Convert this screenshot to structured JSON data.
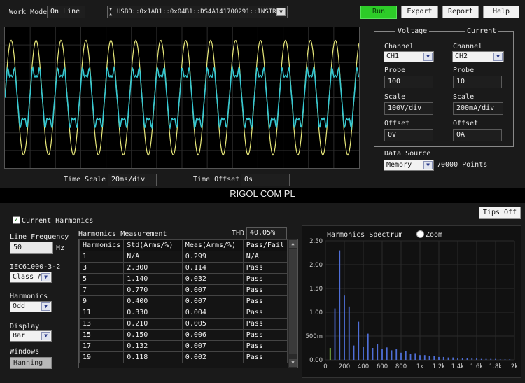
{
  "topbar": {
    "work_mode_label": "Work Mode",
    "work_mode_value": "On Line",
    "resource_value": "USB0::0x1AB1::0x04B1::DS4A141700291::INSTR",
    "buttons": {
      "run": "Run",
      "export": "Export",
      "report": "Report",
      "help": "Help"
    }
  },
  "colors": {
    "run_button": "#2dcc28",
    "voltage_trace": "#e8e87a",
    "current_trace": "#35c8d2",
    "spectrum_bar": "#4f6fd8",
    "spectrum_fundamental": "#8fd14f"
  },
  "scope": {
    "time_scale_label": "Time Scale",
    "time_scale_value": "20ms/div",
    "time_offset_label": "Time Offset",
    "time_offset_value": "0s"
  },
  "voltage": {
    "title": "Voltage",
    "channel_label": "Channel",
    "channel_value": "CH1",
    "probe_label": "Probe",
    "probe_value": "100",
    "scale_label": "Scale",
    "scale_value": "100V/div",
    "offset_label": "Offset",
    "offset_value": "0V"
  },
  "current": {
    "title": "Current",
    "channel_label": "Channel",
    "channel_value": "CH2",
    "probe_label": "Probe",
    "probe_value": "10",
    "scale_label": "Scale",
    "scale_value": "200mA/div",
    "offset_label": "Offset",
    "offset_value": "0A"
  },
  "data_source": {
    "label": "Data Source",
    "value": "Memory",
    "points": "70000 Points"
  },
  "watermark": "RIGOL COM PL",
  "harmonics_panel": {
    "checkbox_label": "Current Harmonics",
    "line_frequency_label": "Line Frequency",
    "line_frequency_value": "50",
    "line_frequency_unit": "Hz",
    "standard_label": "IEC61000-3-2",
    "standard_value": "Class A",
    "harmonics_label": "Harmonics",
    "harmonics_value": "Odd",
    "display_label": "Display",
    "display_value": "Bar",
    "windows_label": "Windows",
    "windows_value": "Hanning",
    "tips_button": "Tips Off"
  },
  "measurement": {
    "title": "Harmonics Measurement",
    "thd_label": "THD",
    "thd_value": "40.05%",
    "columns": [
      "Harmonics",
      "Std(Arms/%)",
      "Meas(Arms/%)",
      "Pass/Fail"
    ],
    "rows": [
      [
        "1",
        "N/A",
        "0.299",
        "N/A"
      ],
      [
        "3",
        "2.300",
        "0.114",
        "Pass"
      ],
      [
        "5",
        "1.140",
        "0.032",
        "Pass"
      ],
      [
        "7",
        "0.770",
        "0.007",
        "Pass"
      ],
      [
        "9",
        "0.400",
        "0.007",
        "Pass"
      ],
      [
        "11",
        "0.330",
        "0.004",
        "Pass"
      ],
      [
        "13",
        "0.210",
        "0.005",
        "Pass"
      ],
      [
        "15",
        "0.150",
        "0.006",
        "Pass"
      ],
      [
        "17",
        "0.132",
        "0.007",
        "Pass"
      ],
      [
        "19",
        "0.118",
        "0.002",
        "Pass"
      ]
    ]
  },
  "spectrum": {
    "title": "Harmonics Spectrum",
    "zoom_label": "Zoom"
  },
  "chart_data": {
    "type": "bar",
    "title": "Harmonics Spectrum",
    "x_tick_labels": [
      "0",
      "200",
      "400",
      "600",
      "800",
      "1k",
      "1.2k",
      "1.4k",
      "1.6k",
      "1.8k",
      "2k"
    ],
    "y_tick_labels": [
      "0.00",
      "500m",
      "1.00",
      "1.50",
      "2.00",
      "2.50"
    ],
    "xlim": [
      0,
      2000
    ],
    "ylim": [
      0,
      2.5
    ],
    "x": [
      50,
      100,
      150,
      200,
      250,
      300,
      350,
      400,
      450,
      500,
      550,
      600,
      650,
      700,
      750,
      800,
      850,
      900,
      950,
      1000,
      1050,
      1100,
      1150,
      1200,
      1250,
      1300,
      1350,
      1400,
      1450,
      1500,
      1550,
      1600,
      1650,
      1700,
      1750,
      1800,
      1850,
      1900,
      1950
    ],
    "values": [
      0.25,
      1.08,
      2.3,
      1.35,
      1.12,
      0.3,
      0.8,
      0.28,
      0.55,
      0.25,
      0.33,
      0.22,
      0.26,
      0.2,
      0.22,
      0.15,
      0.18,
      0.12,
      0.14,
      0.1,
      0.1,
      0.08,
      0.08,
      0.06,
      0.06,
      0.05,
      0.05,
      0.04,
      0.04,
      0.03,
      0.03,
      0.03,
      0.02,
      0.02,
      0.02,
      0.02,
      0.01,
      0.01,
      0.01
    ]
  }
}
